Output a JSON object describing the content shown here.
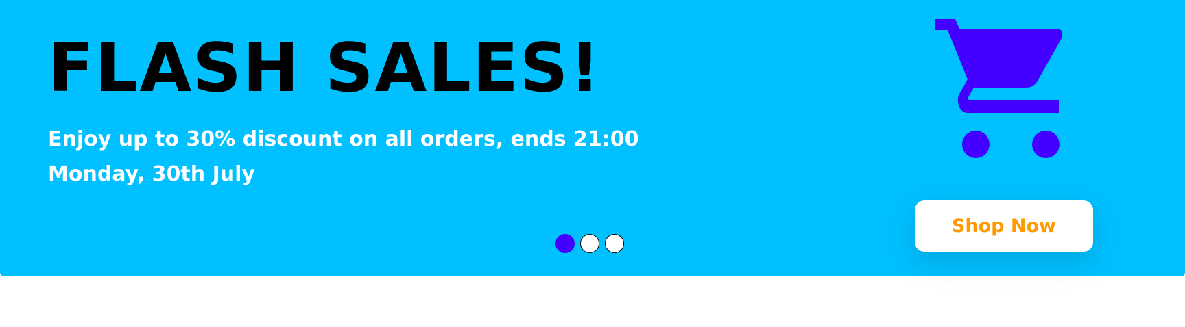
{
  "banner": {
    "headline": "FLASH SALES!",
    "subtext": "Enjoy up to 30% discount on all orders, ends 21:00 Monday, 30th July",
    "cta_label": "Shop Now",
    "icon": "shopping-cart-icon"
  },
  "carousel": {
    "slide_count": 3,
    "active_slide": 1
  },
  "colors": {
    "banner_bg": "#00c0ff",
    "headline": "#000000",
    "subtext": "#ffffff",
    "cart_icon": "#4400ff",
    "cta_text": "#ff9a00",
    "cta_bg": "#ffffff",
    "dot_active": "#4400ff",
    "dot_inactive": "#ffffff"
  }
}
